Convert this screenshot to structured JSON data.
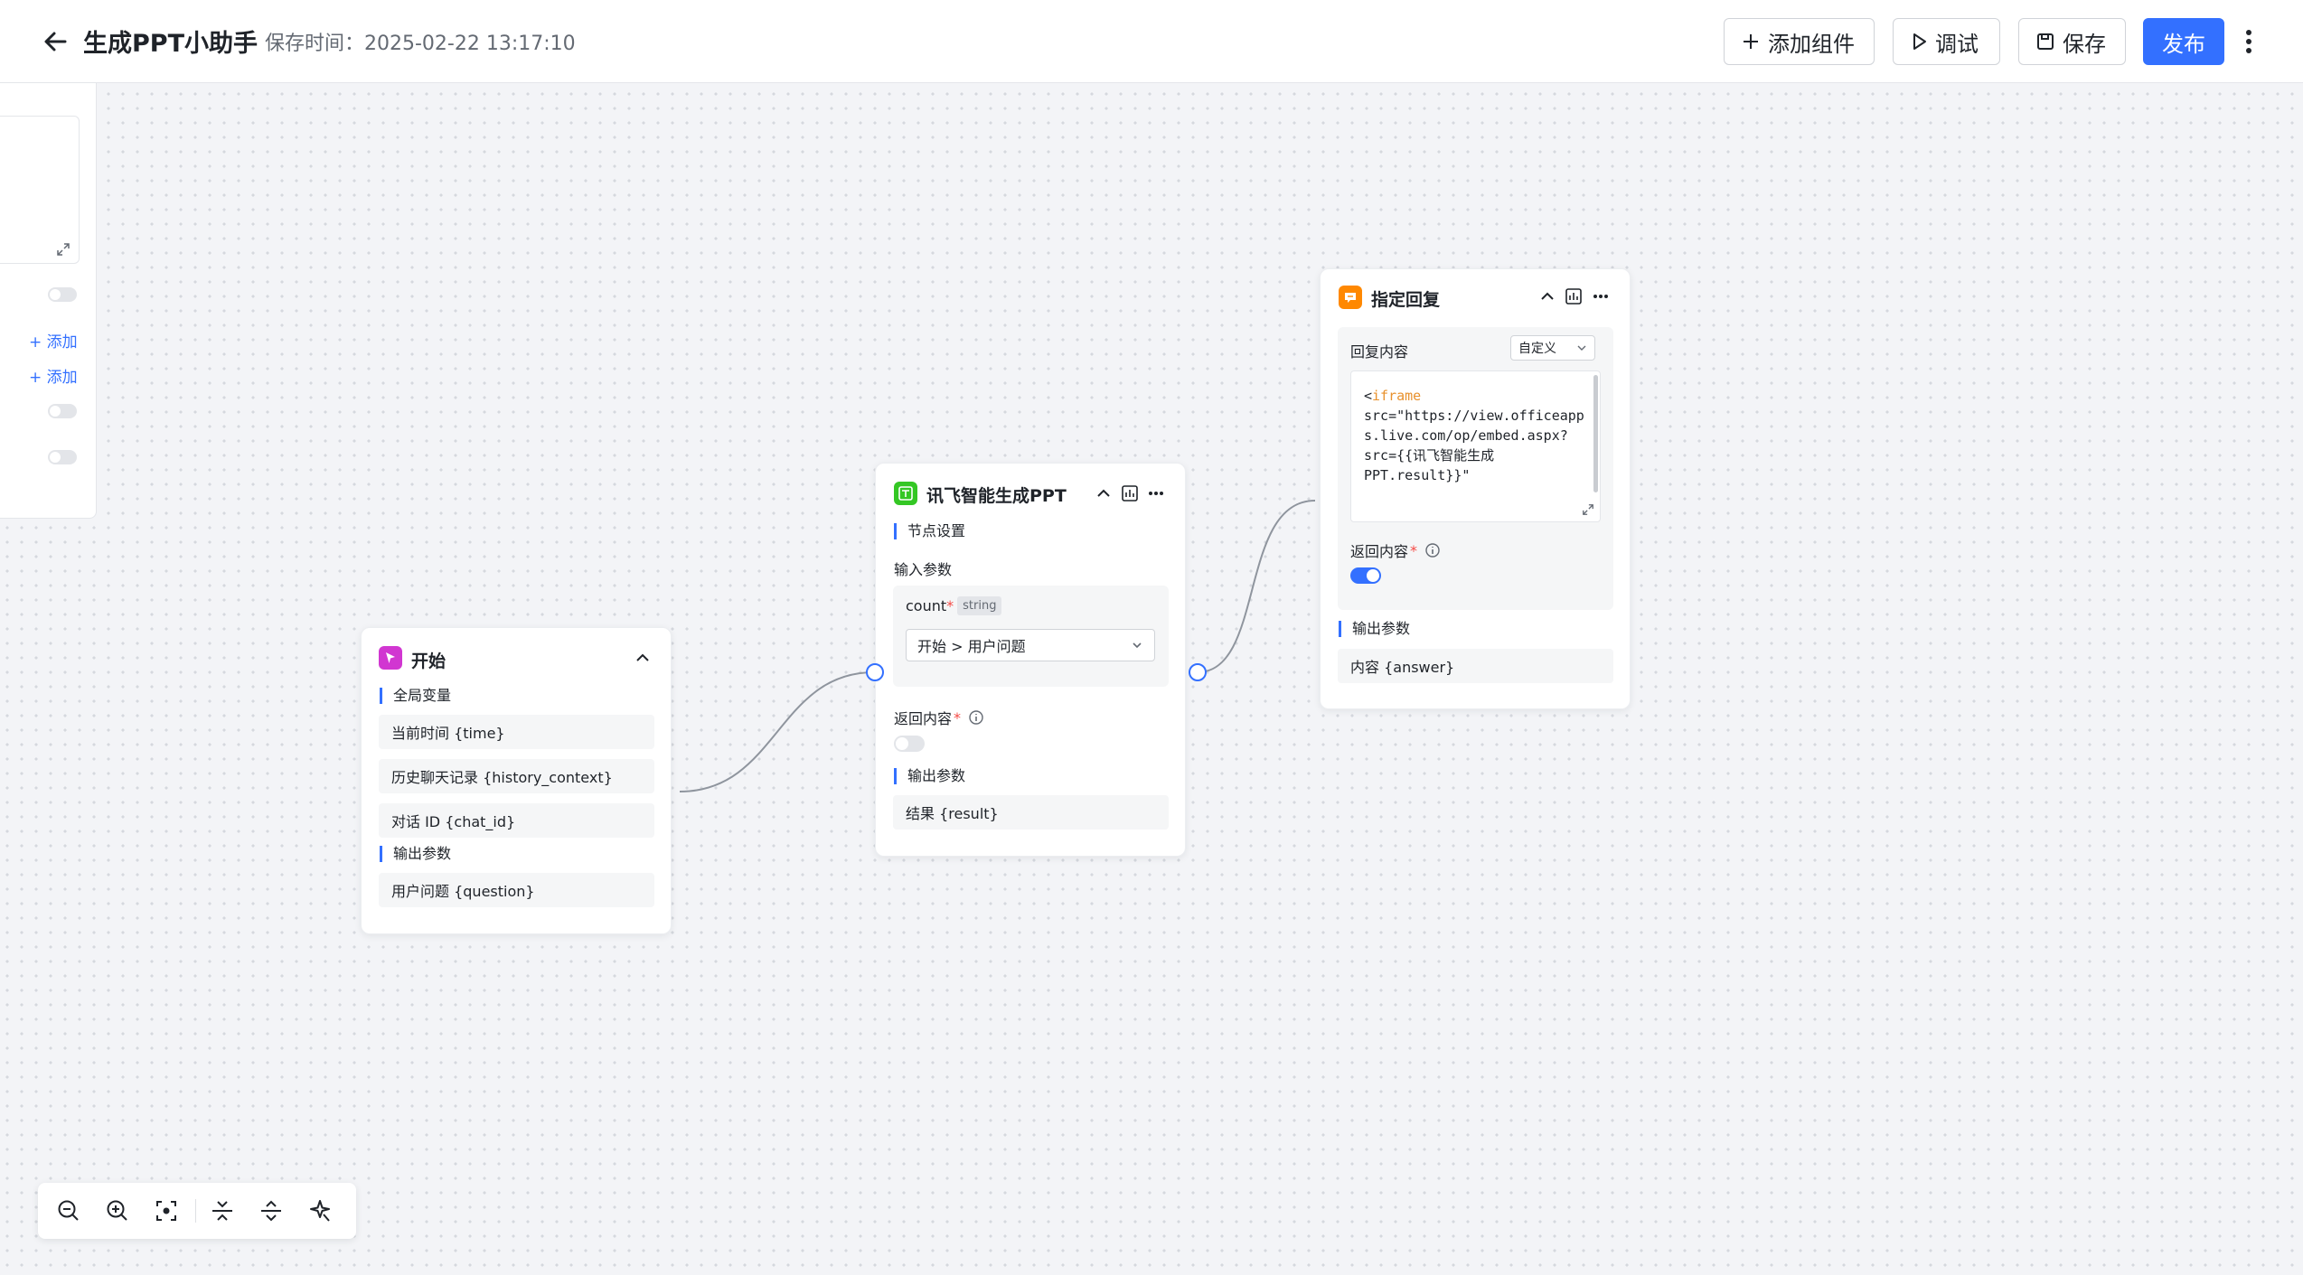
{
  "header": {
    "title": "生成PPT小助手",
    "save_time": "保存时间：2025-02-22 13:17:10",
    "buttons": {
      "add_component": "添加组件",
      "debug": "调试",
      "save": "保存",
      "publish": "发布"
    },
    "accent_color": "#3370ff"
  },
  "left_panel": {
    "add_label_1": "添加",
    "add_label_2": "添加"
  },
  "start_node": {
    "title": "开始",
    "global_vars_label": "全局变量",
    "global_vars": [
      "当前时间 {time}",
      "历史聊天记录 {history_context}",
      "对话 ID {chat_id}"
    ],
    "output_label": "输出参数",
    "outputs": [
      "用户问题 {question}"
    ],
    "icon_color": "#d136d1"
  },
  "ppt_node": {
    "title": "讯飞智能生成PPT",
    "settings_label": "节点设置",
    "input_label": "输入参数",
    "param_name": "count",
    "param_type": "string",
    "param_value": "开始 > 用户问题",
    "return_label": "返回内容",
    "return_enabled": false,
    "output_label": "输出参数",
    "outputs": [
      "结果 {result}"
    ],
    "icon_color": "#34c724"
  },
  "reply_node": {
    "title": "指定回复",
    "content_label": "回复内容",
    "mode": "自定义",
    "code_lines": {
      "l1_open": "<",
      "l1_tag": "iframe",
      "l2": "src=\"https://view.officeapp",
      "l3": "s.live.com/op/embed.aspx?",
      "l4": "src={{讯飞智能生成",
      "l5": "PPT.result}}\""
    },
    "return_label": "返回内容",
    "return_enabled": true,
    "output_label": "输出参数",
    "outputs": [
      "内容 {answer}"
    ],
    "icon_color": "#ff8800"
  },
  "toolbar": {
    "icons": [
      "zoom-out-icon",
      "zoom-in-icon",
      "fit-view-icon",
      "collapse-nodes-icon",
      "expand-nodes-icon",
      "magic-layout-icon"
    ]
  }
}
